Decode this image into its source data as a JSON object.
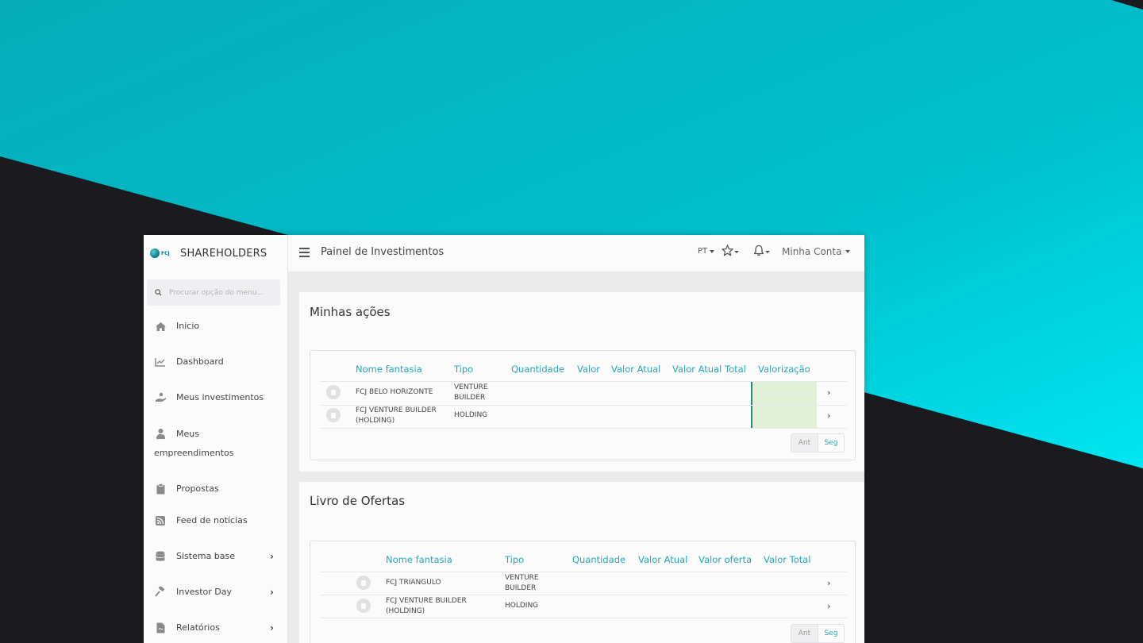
{
  "background": {
    "teal": "#00c9d6",
    "dark": "#1b1a1e"
  },
  "brand": {
    "logo_text": "FCJ",
    "title": "SHAREHOLDERS"
  },
  "search": {
    "placeholder": "Procurar opção do menu..."
  },
  "menu": [
    {
      "label": "Inicio",
      "icon": "home-icon"
    },
    {
      "label": "Dashboard",
      "icon": "line-chart-icon"
    },
    {
      "label": "Meus investimentos",
      "icon": "hand-coin-icon"
    },
    {
      "label_line1": "Meus",
      "label_line2": "empreendimentos",
      "icon": "user-tie-icon"
    },
    {
      "label": "Propostas",
      "icon": "clipboard-icon"
    },
    {
      "label": "Feed de notícias",
      "icon": "rss-icon"
    },
    {
      "label": "Sistema base",
      "icon": "database-icon",
      "chevron": "›"
    },
    {
      "label": "Investor Day",
      "icon": "gavel-icon",
      "chevron": "›"
    },
    {
      "label": "Relatórios",
      "icon": "pdf-file-icon",
      "chevron": "›"
    }
  ],
  "header": {
    "page_title": "Painel de Investimentos",
    "language": "PT",
    "account": "Minha Conta"
  },
  "acoes": {
    "title": "Minhas ações",
    "columns": [
      "Nome fantasia",
      "Tipo",
      "Quantidade",
      "Valor",
      "Valor Atual",
      "Valor Atual Total",
      "Valorização"
    ],
    "rows": [
      {
        "nome": "FCJ BELO HORIZONTE",
        "tipo_l1": "VENTURE",
        "tipo_l2": "BUILDER"
      },
      {
        "nome_l1": "FCJ VENTURE BUILDER",
        "nome_l2": "(HOLDING)",
        "tipo": "HOLDING"
      }
    ],
    "pager": {
      "prev": "Ant",
      "next": "Seg"
    },
    "valorizacao_color": "#e1f0d9"
  },
  "ofertas": {
    "title": "Livro de Ofertas",
    "columns": [
      "Nome fantasia",
      "Tipo",
      "Quantidade",
      "Valor Atual",
      "Valor oferta",
      "Valor Total"
    ],
    "rows": [
      {
        "nome": "FCJ TRIANGULO",
        "tipo_l1": "VENTURE",
        "tipo_l2": "BUILDER"
      },
      {
        "nome_l1": "FCJ VENTURE BUILDER",
        "nome_l2": "(HOLDING)",
        "tipo": "HOLDING"
      }
    ],
    "pager": {
      "prev": "Ant",
      "next": "Seg"
    }
  },
  "accent_color": "#26a7b5"
}
